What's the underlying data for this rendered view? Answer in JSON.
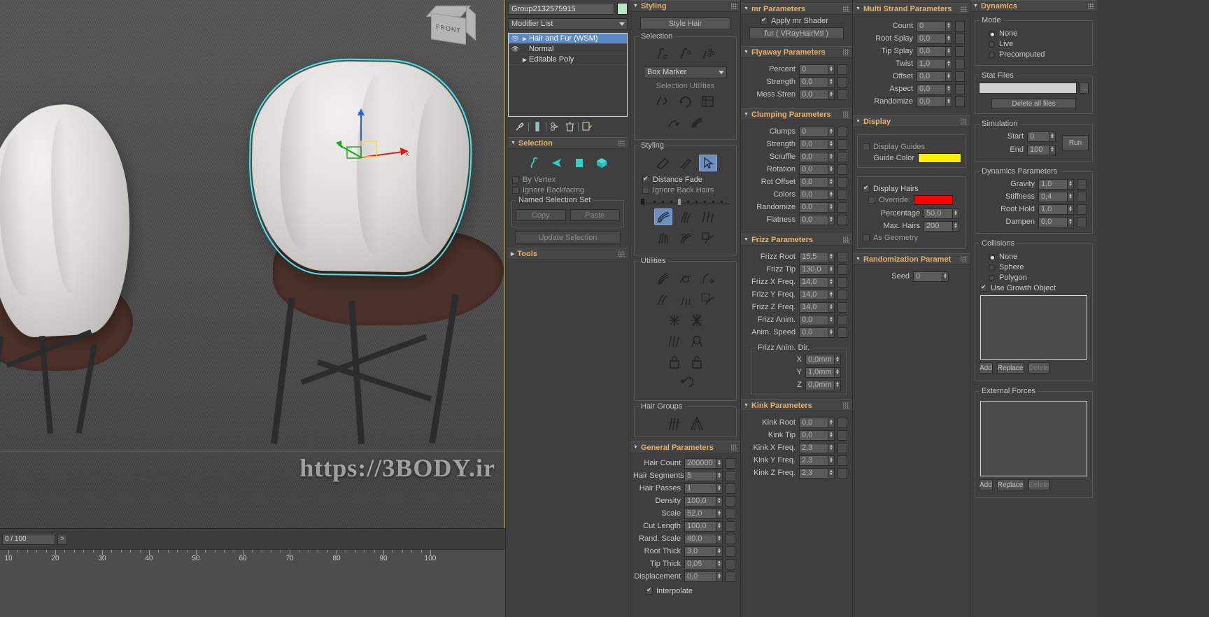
{
  "viewport": {
    "view_label": "FRONT",
    "timeline": {
      "frame_display": "0 / 100",
      "next_button": ">"
    },
    "ruler_ticks": [
      "10",
      "20",
      "30",
      "40",
      "50",
      "60",
      "70",
      "80",
      "90",
      "100"
    ],
    "watermark": "https://3BODY.ir"
  },
  "modifier_panel": {
    "object_name": "Group2132575915",
    "object_color": "#b8e6c4",
    "modifier_list_label": "Modifier List",
    "stack": [
      {
        "label": "Hair and Fur (WSM)",
        "selected": true,
        "eye": true,
        "expandable": true
      },
      {
        "label": "Normal",
        "selected": false,
        "eye": true,
        "expandable": false
      },
      {
        "label": "Editable Poly",
        "selected": false,
        "eye": false,
        "expandable": true
      }
    ],
    "stack_tools": [
      "pin-stack",
      "show-end-result",
      "make-unique",
      "remove-modifier",
      "configure-sets"
    ],
    "selection_rollout": {
      "title": "Selection",
      "sub_icons": [
        "guide-icon",
        "vertex-icon",
        "segment-icon",
        "element-icon"
      ],
      "by_vertex": "By Vertex",
      "ignore_backfacing": "Ignore Backfacing",
      "named_selection_set": "Named Selection Set",
      "copy": "Copy",
      "paste": "Paste",
      "update_selection": "Update Selection"
    },
    "tools_rollout": {
      "title": "Tools"
    }
  },
  "styling_panel": {
    "title": "Styling",
    "style_hair_button": "Style Hair",
    "selection_group": {
      "title": "Selection",
      "box_marker": "Box Marker",
      "selection_utilities": "Selection Utilities"
    },
    "styling_group": {
      "title": "Styling",
      "distance_fade": "Distance Fade",
      "ignore_back_hairs": "Ignore Back Hairs"
    },
    "utilities_group": {
      "title": "Utilities"
    },
    "hair_groups": {
      "title": "Hair Groups"
    }
  },
  "general_parameters": {
    "title": "General Parameters",
    "rows": [
      {
        "label": "Hair Count",
        "value": "200000"
      },
      {
        "label": "Hair Segments",
        "value": "5"
      },
      {
        "label": "Hair Passes",
        "value": "1"
      },
      {
        "label": "Density",
        "value": "100,0"
      },
      {
        "label": "Scale",
        "value": "52,0"
      },
      {
        "label": "Cut Length",
        "value": "100,0"
      },
      {
        "label": "Rand. Scale",
        "value": "40,0"
      },
      {
        "label": "Root Thick",
        "value": "3,0"
      },
      {
        "label": "Tip Thick",
        "value": "0,05"
      },
      {
        "label": "Displacement",
        "value": "0,0"
      }
    ],
    "interpolate": "Interpolate"
  },
  "mr_parameters": {
    "title": "mr Parameters",
    "apply_mr_shader": "Apply mr Shader",
    "shader_name": "fur  ( VRayHairMtl )"
  },
  "flyaway_parameters": {
    "title": "Flyaway Parameters",
    "rows": [
      {
        "label": "Percent",
        "value": "0"
      },
      {
        "label": "Strength",
        "value": "0,0"
      },
      {
        "label": "Mess Stren",
        "value": "0,0"
      }
    ]
  },
  "clumping_parameters": {
    "title": "Clumping Parameters",
    "rows": [
      {
        "label": "Clumps",
        "value": "0"
      },
      {
        "label": "Strength",
        "value": "0,0"
      },
      {
        "label": "Scruffle",
        "value": "0,0"
      },
      {
        "label": "Rotation",
        "value": "0,0"
      },
      {
        "label": "Rot Offset",
        "value": "0,0"
      },
      {
        "label": "Colors",
        "value": "0,0"
      },
      {
        "label": "Randomize",
        "value": "0,0"
      },
      {
        "label": "Flatness",
        "value": "0,0"
      }
    ]
  },
  "frizz_parameters": {
    "title": "Frizz Parameters",
    "rows": [
      {
        "label": "Frizz Root",
        "value": "15,5"
      },
      {
        "label": "Frizz Tip",
        "value": "130,0"
      },
      {
        "label": "Frizz X Freq.",
        "value": "14,0"
      },
      {
        "label": "Frizz Y Freq.",
        "value": "14,0"
      },
      {
        "label": "Frizz Z Freq.",
        "value": "14,0"
      },
      {
        "label": "Frizz Anim.",
        "value": "0,0"
      },
      {
        "label": "Anim. Speed",
        "value": "0,0"
      }
    ],
    "anim_dir_title": "Frizz Anim. Dir.",
    "anim_dir": [
      {
        "label": "X",
        "value": "0,0mm"
      },
      {
        "label": "Y",
        "value": "1,0mm"
      },
      {
        "label": "Z",
        "value": "0,0mm"
      }
    ]
  },
  "kink_parameters": {
    "title": "Kink Parameters",
    "rows": [
      {
        "label": "Kink Root",
        "value": "0,0"
      },
      {
        "label": "Kink Tip",
        "value": "0,0"
      },
      {
        "label": "Kink X Freq.",
        "value": "2,3"
      },
      {
        "label": "Kink Y Freq.",
        "value": "2,3"
      },
      {
        "label": "Kink Z Freq.",
        "value": "2,3"
      }
    ]
  },
  "multi_strand_parameters": {
    "title": "Multi Strand Parameters",
    "rows": [
      {
        "label": "Count",
        "value": "0"
      },
      {
        "label": "Root Splay",
        "value": "0,0"
      },
      {
        "label": "Tip Splay",
        "value": "0,0"
      },
      {
        "label": "Twist",
        "value": "1,0"
      },
      {
        "label": "Offset",
        "value": "0,0"
      },
      {
        "label": "Aspect",
        "value": "0,0"
      },
      {
        "label": "Randomize",
        "value": "0,0"
      }
    ]
  },
  "display": {
    "title": "Display",
    "display_guides": "Display Guides",
    "guide_color_label": "Guide Color",
    "guide_color": "#fff200",
    "display_hairs": "Display Hairs",
    "override_label": "Override:",
    "override_color": "#ff0000",
    "percentage_label": "Percentage",
    "percentage_value": "50,0",
    "max_hairs_label": "Max. Hairs",
    "max_hairs_value": "200",
    "as_geometry": "As Geometry"
  },
  "randomization": {
    "title": "Randomization Paramet",
    "seed_label": "Seed",
    "seed_value": "0"
  },
  "dynamics": {
    "title": "Dynamics",
    "mode_title": "Mode",
    "modes": [
      {
        "label": "None",
        "selected": true
      },
      {
        "label": "Live",
        "selected": false
      },
      {
        "label": "Precomputed",
        "selected": false
      }
    ],
    "stat_files_title": "Stat Files",
    "stat_path": "",
    "browse_button": "...",
    "delete_all_files": "Delete all files",
    "simulation_title": "Simulation",
    "start_label": "Start",
    "start_value": "0",
    "end_label": "End",
    "end_value": "100",
    "run_button": "Run",
    "dyn_params_title": "Dynamics Parameters",
    "dyn_rows": [
      {
        "label": "Gravity",
        "value": "1,0"
      },
      {
        "label": "Stiffness",
        "value": "0,4"
      },
      {
        "label": "Root Hold",
        "value": "1,0"
      },
      {
        "label": "Dampen",
        "value": "0,0"
      }
    ],
    "collisions_title": "Collisions",
    "collisions": [
      {
        "label": "None",
        "selected": true
      },
      {
        "label": "Sphere",
        "selected": false
      },
      {
        "label": "Polygon",
        "selected": false
      }
    ],
    "use_growth_object": "Use Growth Object",
    "growth_buttons": [
      "Add",
      "Replace",
      "Delete"
    ],
    "external_forces_title": "External Forces",
    "forces_buttons": [
      "Add",
      "Replace",
      "Delete"
    ]
  }
}
